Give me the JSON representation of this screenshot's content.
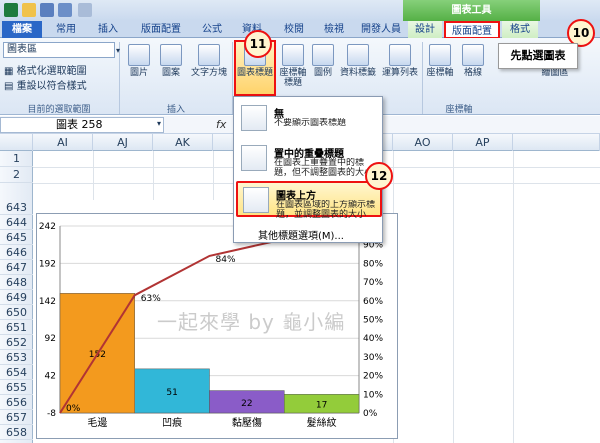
{
  "window": {
    "context_group": "圖表工具"
  },
  "tabs": [
    {
      "label": "檔案"
    },
    {
      "label": "常用"
    },
    {
      "label": "插入"
    },
    {
      "label": "版面配置"
    },
    {
      "label": "公式"
    },
    {
      "label": "資料"
    },
    {
      "label": "校閱"
    },
    {
      "label": "檢視"
    },
    {
      "label": "開發人員"
    },
    {
      "label": "設計"
    },
    {
      "label": "版面配置"
    },
    {
      "label": "格式"
    }
  ],
  "ribbon": {
    "selection_box": "圖表區",
    "format_selection": "格式化選取範圍",
    "reset_match": "重設以符合樣式",
    "group_current": "目前的選取範圍",
    "group_insert": "插入",
    "group_axes": "座標軸",
    "insert_buttons": [
      "圖片",
      "圖案",
      "文字方塊"
    ],
    "label_buttons": [
      "圖表標題",
      "座標軸標題",
      "圖例",
      "資料標籤",
      "運算列表"
    ],
    "axes_buttons": [
      "座標軸",
      "格線",
      "繪圖區"
    ]
  },
  "formula_bar": {
    "name_box": "圖表 258",
    "fx": "fx"
  },
  "columns": [
    "AI",
    "AJ",
    "AK",
    "AO",
    "AP"
  ],
  "rows": [
    "1",
    "2",
    "643",
    "644",
    "645",
    "646",
    "647",
    "648",
    "649",
    "650",
    "651",
    "652",
    "653",
    "654",
    "655",
    "656",
    "657",
    "658"
  ],
  "dropdown": {
    "items": [
      {
        "title": "無",
        "desc": "不要顯示圖表標題"
      },
      {
        "title": "置中的重疊標題",
        "desc": "在圖表上重疊置中的標題，但不調整圖表的大小"
      },
      {
        "title": "圖表上方",
        "desc": "在圖表區域的上方顯示標題，並調整圖表的大小"
      }
    ],
    "more": "其他標題選項(M)..."
  },
  "annotations": {
    "badge_10": "10",
    "badge_11": "11",
    "badge_12": "12",
    "callout": "先點選圖表"
  },
  "watermark": "一起來學 by 龜小編",
  "colors": {
    "accent": "#e11",
    "bar_orange": "#f39a1e",
    "bar_cyan": "#31b7d8",
    "bar_purple": "#8a5cc8",
    "bar_green": "#93cc3a",
    "line": "#b13434"
  },
  "chart_data": {
    "type": "bar",
    "categories": [
      "毛邊",
      "凹痕",
      "黏壓傷",
      "髮絲紋"
    ],
    "values": [
      152,
      51,
      22,
      17
    ],
    "cumulative_pct_labels": [
      "0%",
      "63%",
      "84%",
      ""
    ],
    "cumulative": [
      0,
      63,
      84,
      93,
      100
    ],
    "y_ticks": [
      "-8",
      "42",
      "92",
      "142",
      "192",
      "242"
    ],
    "ylim": [
      -8,
      242
    ],
    "y2_ticks": [
      "0%",
      "10%",
      "20%",
      "30%",
      "40%",
      "50%",
      "60%",
      "70%",
      "80%",
      "90%"
    ],
    "y2lim": [
      0,
      100
    ],
    "grid": true
  }
}
